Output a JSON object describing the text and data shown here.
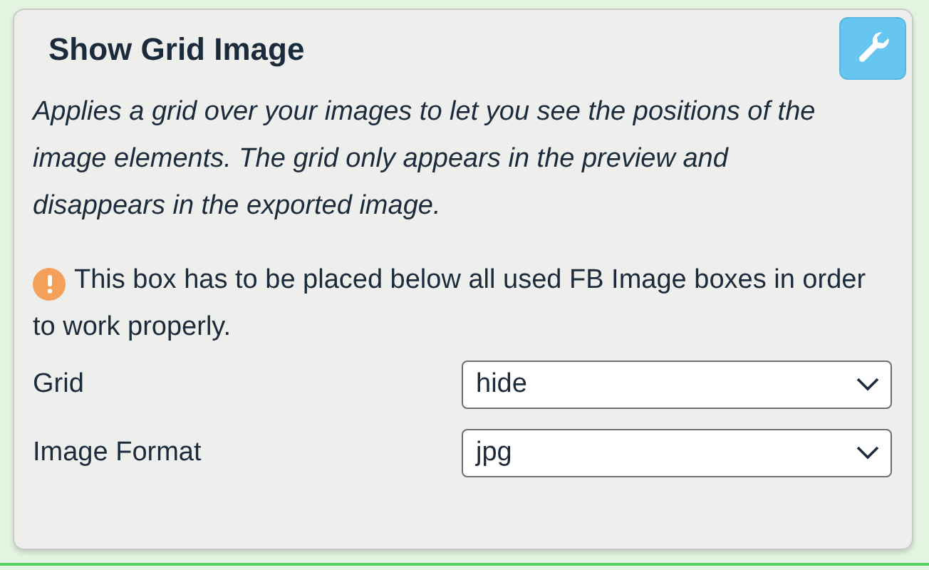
{
  "panel": {
    "title": "Show Grid Image",
    "description": "Applies a grid over your images to let you see the positions of the image elements. The grid only appears in the preview and disappears in the exported image.",
    "warning": "This box has to be placed below all used FB Image boxes in order to work properly.",
    "fields": [
      {
        "label": "Grid",
        "value": "hide"
      },
      {
        "label": "Image Format",
        "value": "jpg"
      }
    ]
  }
}
